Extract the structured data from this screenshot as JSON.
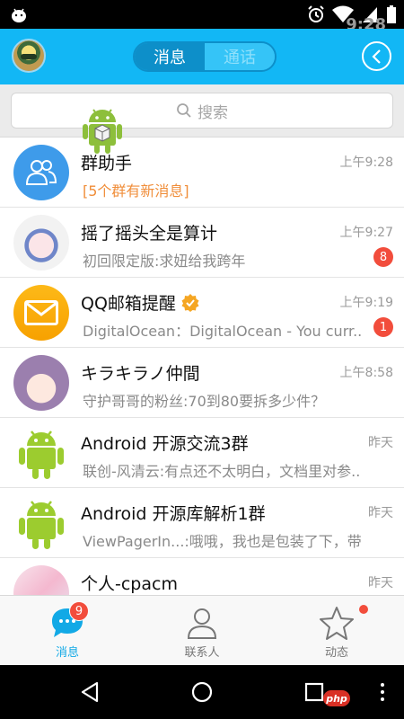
{
  "status_bar": {
    "time": "9:28"
  },
  "header": {
    "tabs": [
      {
        "label": "消息",
        "active": true
      },
      {
        "label": "通话",
        "active": false
      }
    ]
  },
  "search": {
    "placeholder": "搜索"
  },
  "conversations": [
    {
      "name": "群助手",
      "preview": "[5个群有新消息]",
      "time": "上午9:28",
      "badge": "",
      "avatar": "group-icon"
    },
    {
      "name": "摇了摇头全是算计",
      "preview": "初回限定版:求妞给我跨年",
      "time": "上午9:27",
      "badge": "8",
      "avatar": "anime-avatar"
    },
    {
      "name": "QQ邮箱提醒",
      "preview": "DigitalOcean：DigitalOcean - You curr...",
      "time": "上午9:19",
      "badge": "1",
      "avatar": "mail-icon"
    },
    {
      "name": "キラキラノ仲間",
      "preview": "守护哥哥的粉丝:70到80要拆多少件？",
      "time": "上午8:58",
      "badge": "",
      "avatar": "anime-avatar"
    },
    {
      "name": "Android 开源交流3群",
      "preview": "联创-风清云:有点还不太明白，文档里对参...",
      "time": "昨天",
      "badge": "",
      "avatar": "android-icon"
    },
    {
      "name": "Android 开源库解析1群",
      "preview": "ViewPagerIn...:哦哦，我也是包装了下，带...",
      "time": "昨天",
      "badge": "",
      "avatar": "android-icon"
    },
    {
      "name": "个人-cpacm",
      "preview": "",
      "time": "昨天",
      "badge": "",
      "avatar": "anime-avatar"
    }
  ],
  "tabbar": {
    "items": [
      {
        "label": "消息",
        "count": "9",
        "icon": "chat-bubble-icon"
      },
      {
        "label": "联系人",
        "icon": "person-icon"
      },
      {
        "label": "动态",
        "icon": "star-icon"
      }
    ]
  },
  "watermark": {
    "text": "php"
  },
  "colors": {
    "accent": "#12b7f5",
    "badge": "#f24d3c",
    "highlight_text": "#f08e3a"
  }
}
